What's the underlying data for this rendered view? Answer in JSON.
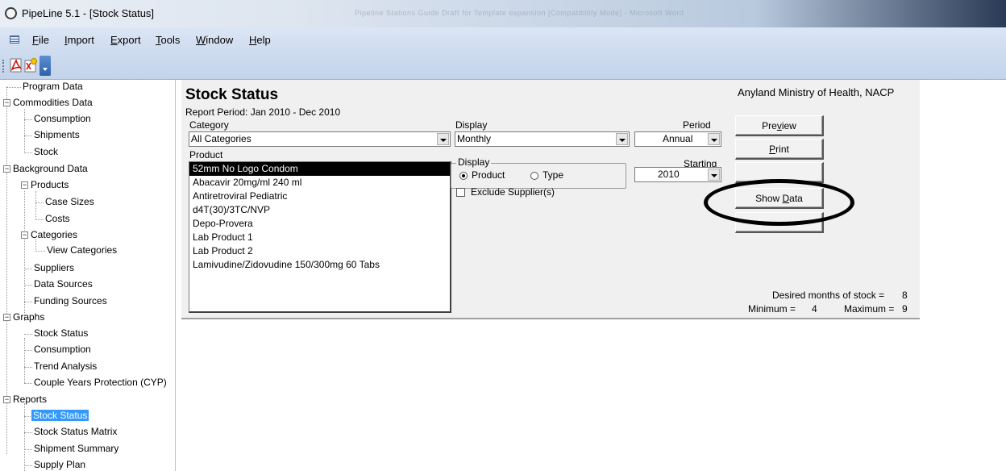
{
  "window": {
    "title": "PipeLine 5.1 - [Stock Status]",
    "blurred_title": "Pipeline Stations Guide Draft for Template expansion [Compatibility Mode] - Microsoft Word"
  },
  "menubar": {
    "items": [
      {
        "pre": "",
        "key": "F",
        "post": "ile"
      },
      {
        "pre": "",
        "key": "I",
        "post": "mport"
      },
      {
        "pre": "",
        "key": "E",
        "post": "xport"
      },
      {
        "pre": "",
        "key": "T",
        "post": "ools"
      },
      {
        "pre": "",
        "key": "W",
        "post": "indow"
      },
      {
        "pre": "",
        "key": "H",
        "post": "elp"
      }
    ]
  },
  "toolbar": {
    "icons": [
      "pdf-export-icon",
      "excel-export-icon",
      "toolbar-overflow-icon"
    ]
  },
  "tree": {
    "program_data": "Program Data",
    "commodities_data": "Commodities Data",
    "consumption": "Consumption",
    "shipments": "Shipments",
    "stock": "Stock",
    "background_data": "Background Data",
    "products": "Products",
    "case_sizes": "Case Sizes",
    "costs": "Costs",
    "categories": "Categories",
    "view_categories": "View Categories",
    "suppliers": "Suppliers",
    "data_sources": "Data Sources",
    "funding_sources": "Funding Sources",
    "graphs": "Graphs",
    "g_stock_status": "Stock Status",
    "g_consumption": "Consumption",
    "g_trend": "Trend Analysis",
    "g_cyp": "Couple Years Protection (CYP)",
    "reports": "Reports",
    "r_stock_status": "Stock Status",
    "r_stock_status_matrix": "Stock Status Matrix",
    "r_shipment_summary": "Shipment Summary",
    "r_supply_plan": "Supply Plan"
  },
  "report": {
    "title": "Stock Status",
    "period": "Report Period: Jan 2010 - Dec 2010",
    "org": "Anyland Ministry of Health, NACP",
    "category_label": "Category",
    "category_value": "All Categories",
    "display_label": "Display",
    "display_value": "Monthly",
    "period_label": "Period",
    "period_value": "Annual",
    "product_label": "Product",
    "display_group_label": "Display",
    "radio_product": "Product",
    "radio_type": "Type",
    "starting_label": "Starting",
    "starting_value": "2010",
    "exclude_suppliers": "Exclude Supplier(s)",
    "products": [
      "52mm No Logo Condom",
      "Abacavir 20mg/ml 240 ml",
      "Antiretroviral Pediatric",
      "d4T(30)/3TC/NVP",
      "Depo-Provera",
      "Lab Product 1",
      "Lab Product 2",
      "Lamivudine/Zidovudine 150/300mg 60 Tabs"
    ],
    "selected_product": "52mm No Logo Condom",
    "buttons": {
      "preview_pre": "Pre",
      "preview_key": "v",
      "preview_post": "iew",
      "print_key": "P",
      "print_post": "rint",
      "show_data_pre": "Show ",
      "show_data_key": "D",
      "show_data_post": "ata"
    },
    "desired_months_label": "Desired months of stock =",
    "desired_months_value": "8",
    "minimum_label": "Minimum =",
    "minimum_value": "4",
    "maximum_label": "Maximum =",
    "maximum_value": "9"
  }
}
